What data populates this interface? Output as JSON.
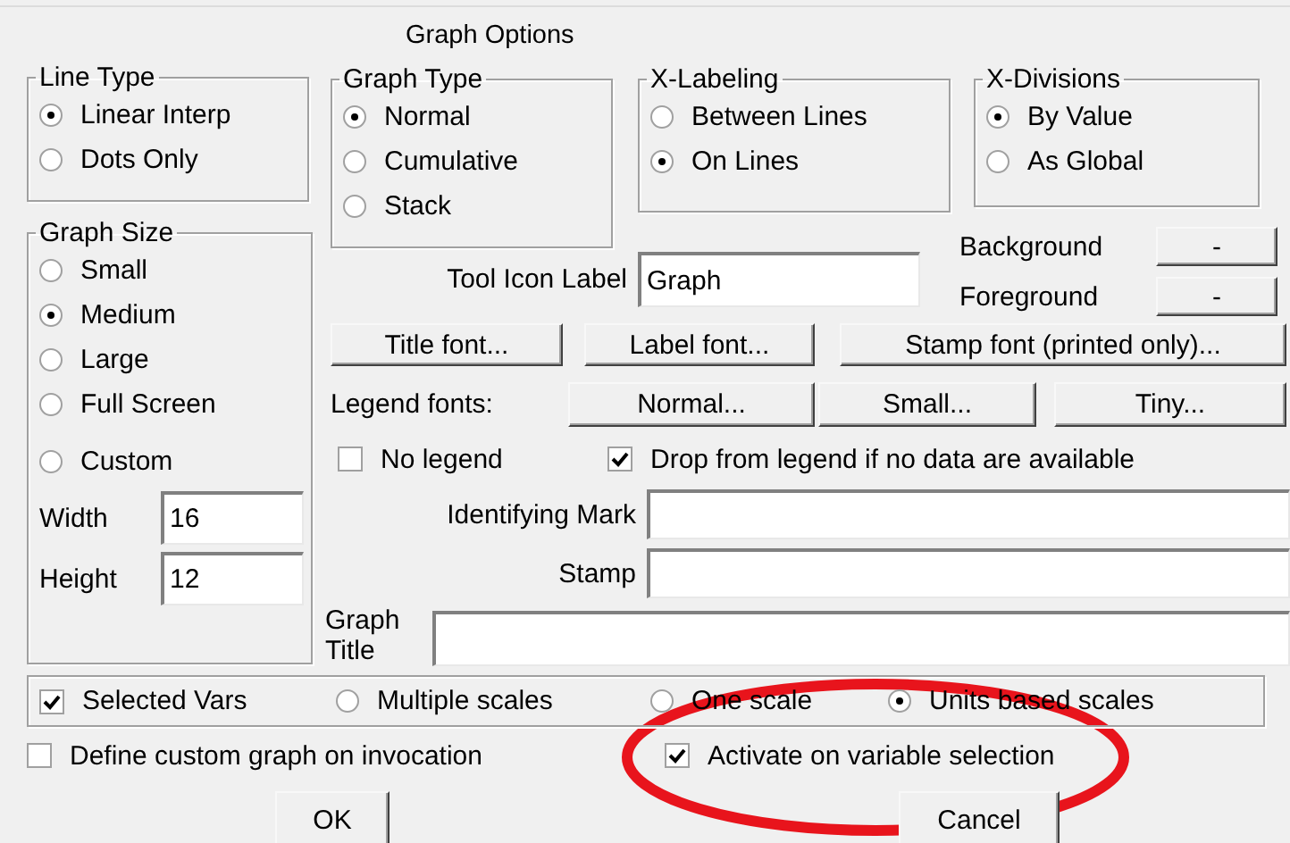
{
  "title": "Graph Options",
  "line_type": {
    "label": "Line Type",
    "options": [
      {
        "label": "Linear Interp",
        "selected": true
      },
      {
        "label": "Dots Only",
        "selected": false
      }
    ]
  },
  "graph_type": {
    "label": "Graph Type",
    "options": [
      {
        "label": "Normal",
        "selected": true
      },
      {
        "label": "Cumulative",
        "selected": false
      },
      {
        "label": "Stack",
        "selected": false
      }
    ]
  },
  "x_labeling": {
    "label": "X-Labeling",
    "options": [
      {
        "label": "Between Lines",
        "selected": false
      },
      {
        "label": "On Lines",
        "selected": true
      }
    ]
  },
  "x_divisions": {
    "label": "X-Divisions",
    "options": [
      {
        "label": "By Value",
        "selected": true
      },
      {
        "label": "As Global",
        "selected": false
      }
    ]
  },
  "graph_size": {
    "label": "Graph Size",
    "options": [
      {
        "label": "Small",
        "selected": false
      },
      {
        "label": "Medium",
        "selected": true
      },
      {
        "label": "Large",
        "selected": false
      },
      {
        "label": "Full Screen",
        "selected": false
      },
      {
        "label": "Custom",
        "selected": false
      }
    ],
    "width": {
      "label": "Width",
      "value": "16"
    },
    "height": {
      "label": "Height",
      "value": "12"
    }
  },
  "colors": [
    {
      "label": "Background",
      "button": "-"
    },
    {
      "label": "Foreground",
      "button": "-"
    }
  ],
  "tool_icon_label": {
    "label": "Tool Icon Label",
    "value": "Graph"
  },
  "font_buttons": [
    "Title font...",
    "Label font...",
    "Stamp font (printed only)..."
  ],
  "legend_fonts": {
    "label": "Legend fonts:",
    "buttons": [
      "Normal...",
      "Small...",
      "Tiny..."
    ]
  },
  "legend_options": [
    {
      "label": "No legend",
      "checked": false
    },
    {
      "label": "Drop from legend if no data are available",
      "checked": true
    }
  ],
  "identifying_mark": {
    "label": "Identifying Mark"
  },
  "stamp": {
    "label": "Stamp"
  },
  "graph_title": {
    "label": "Graph Title"
  },
  "scales": {
    "selected_vars": {
      "label": "Selected Vars",
      "checked": true
    },
    "options": [
      {
        "label": "Multiple scales",
        "selected": false
      },
      {
        "label": "One scale",
        "selected": false
      },
      {
        "label": "Units based scales",
        "selected": true
      }
    ]
  },
  "define_custom": {
    "label": "Define custom graph on invocation",
    "checked": false
  },
  "activate": {
    "label": "Activate on variable selection",
    "checked": true
  },
  "buttons": [
    "OK",
    "Cancel"
  ],
  "annotation": {
    "kind": "ellipse"
  }
}
